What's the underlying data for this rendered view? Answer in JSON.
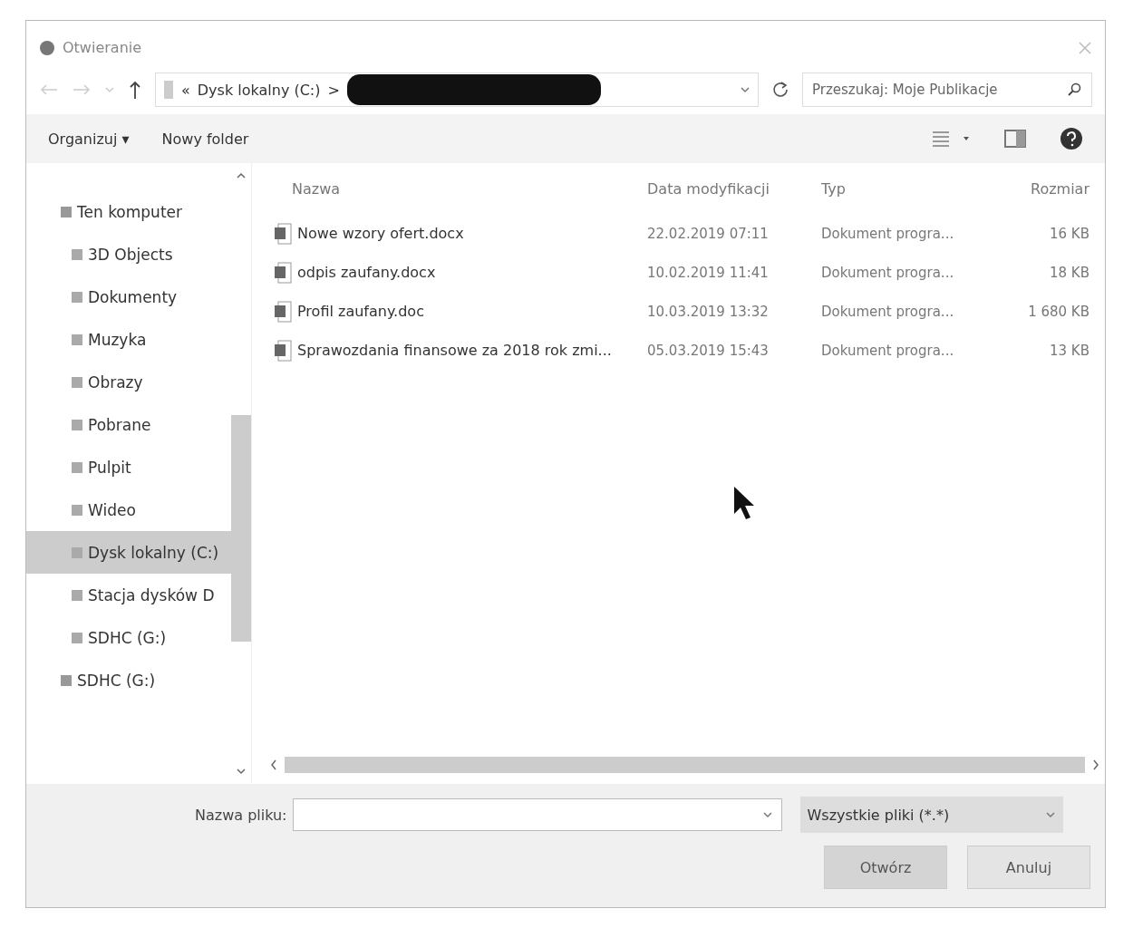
{
  "window": {
    "title": "Otwieranie"
  },
  "address_bar": {
    "path": [
      "«",
      "Dysk lokalny (C:)",
      ">"
    ],
    "redacted": true
  },
  "search": {
    "placeholder": "Przeszukaj: Moje Publikacje"
  },
  "toolbar": {
    "items": [
      "Organizuj ▾",
      "Nowy folder"
    ]
  },
  "sidebar": {
    "items": [
      {
        "label": "Ten komputer",
        "selected": false,
        "children": [
          {
            "label": "3D Objects",
            "selected": false
          },
          {
            "label": "Dokumenty",
            "selected": false
          },
          {
            "label": "Muzyka",
            "selected": false
          },
          {
            "label": "Obrazy",
            "selected": false
          },
          {
            "label": "Pobrane",
            "selected": false
          },
          {
            "label": "Pulpit",
            "selected": false
          },
          {
            "label": "Wideo",
            "selected": false
          },
          {
            "label": "Dysk lokalny (C:)",
            "selected": true
          },
          {
            "label": "Stacja dysków D",
            "selected": false
          },
          {
            "label": "SDHC (G:)",
            "selected": false
          }
        ]
      },
      {
        "label": "SDHC (G:)",
        "selected": false
      }
    ]
  },
  "table": {
    "columns": [
      "Nazwa",
      "Data modyfikacji",
      "Typ",
      "Rozmiar"
    ],
    "rows": [
      {
        "cells": [
          "Nowe wzory ofert.docx",
          "22.02.2019 07:11",
          "Dokument progra...",
          "16 KB"
        ]
      },
      {
        "cells": [
          "odpis zaufany.docx",
          "10.02.2019 11:41",
          "Dokument progra...",
          "18 KB"
        ]
      },
      {
        "cells": [
          "Profil zaufany.doc",
          "10.03.2019 13:32",
          "Dokument progra...",
          "1 680 KB"
        ]
      },
      {
        "cells": [
          "Sprawozdania finansowe za 2018 rok zmi...",
          "05.03.2019 15:43",
          "Dokument progra...",
          "13 KB"
        ]
      }
    ]
  },
  "footer": {
    "filename_label": "Nazwa pliku:",
    "filter": "Wszystkie pliki (*.*)",
    "buttons": [
      "Otwórz",
      "Anuluj"
    ]
  }
}
